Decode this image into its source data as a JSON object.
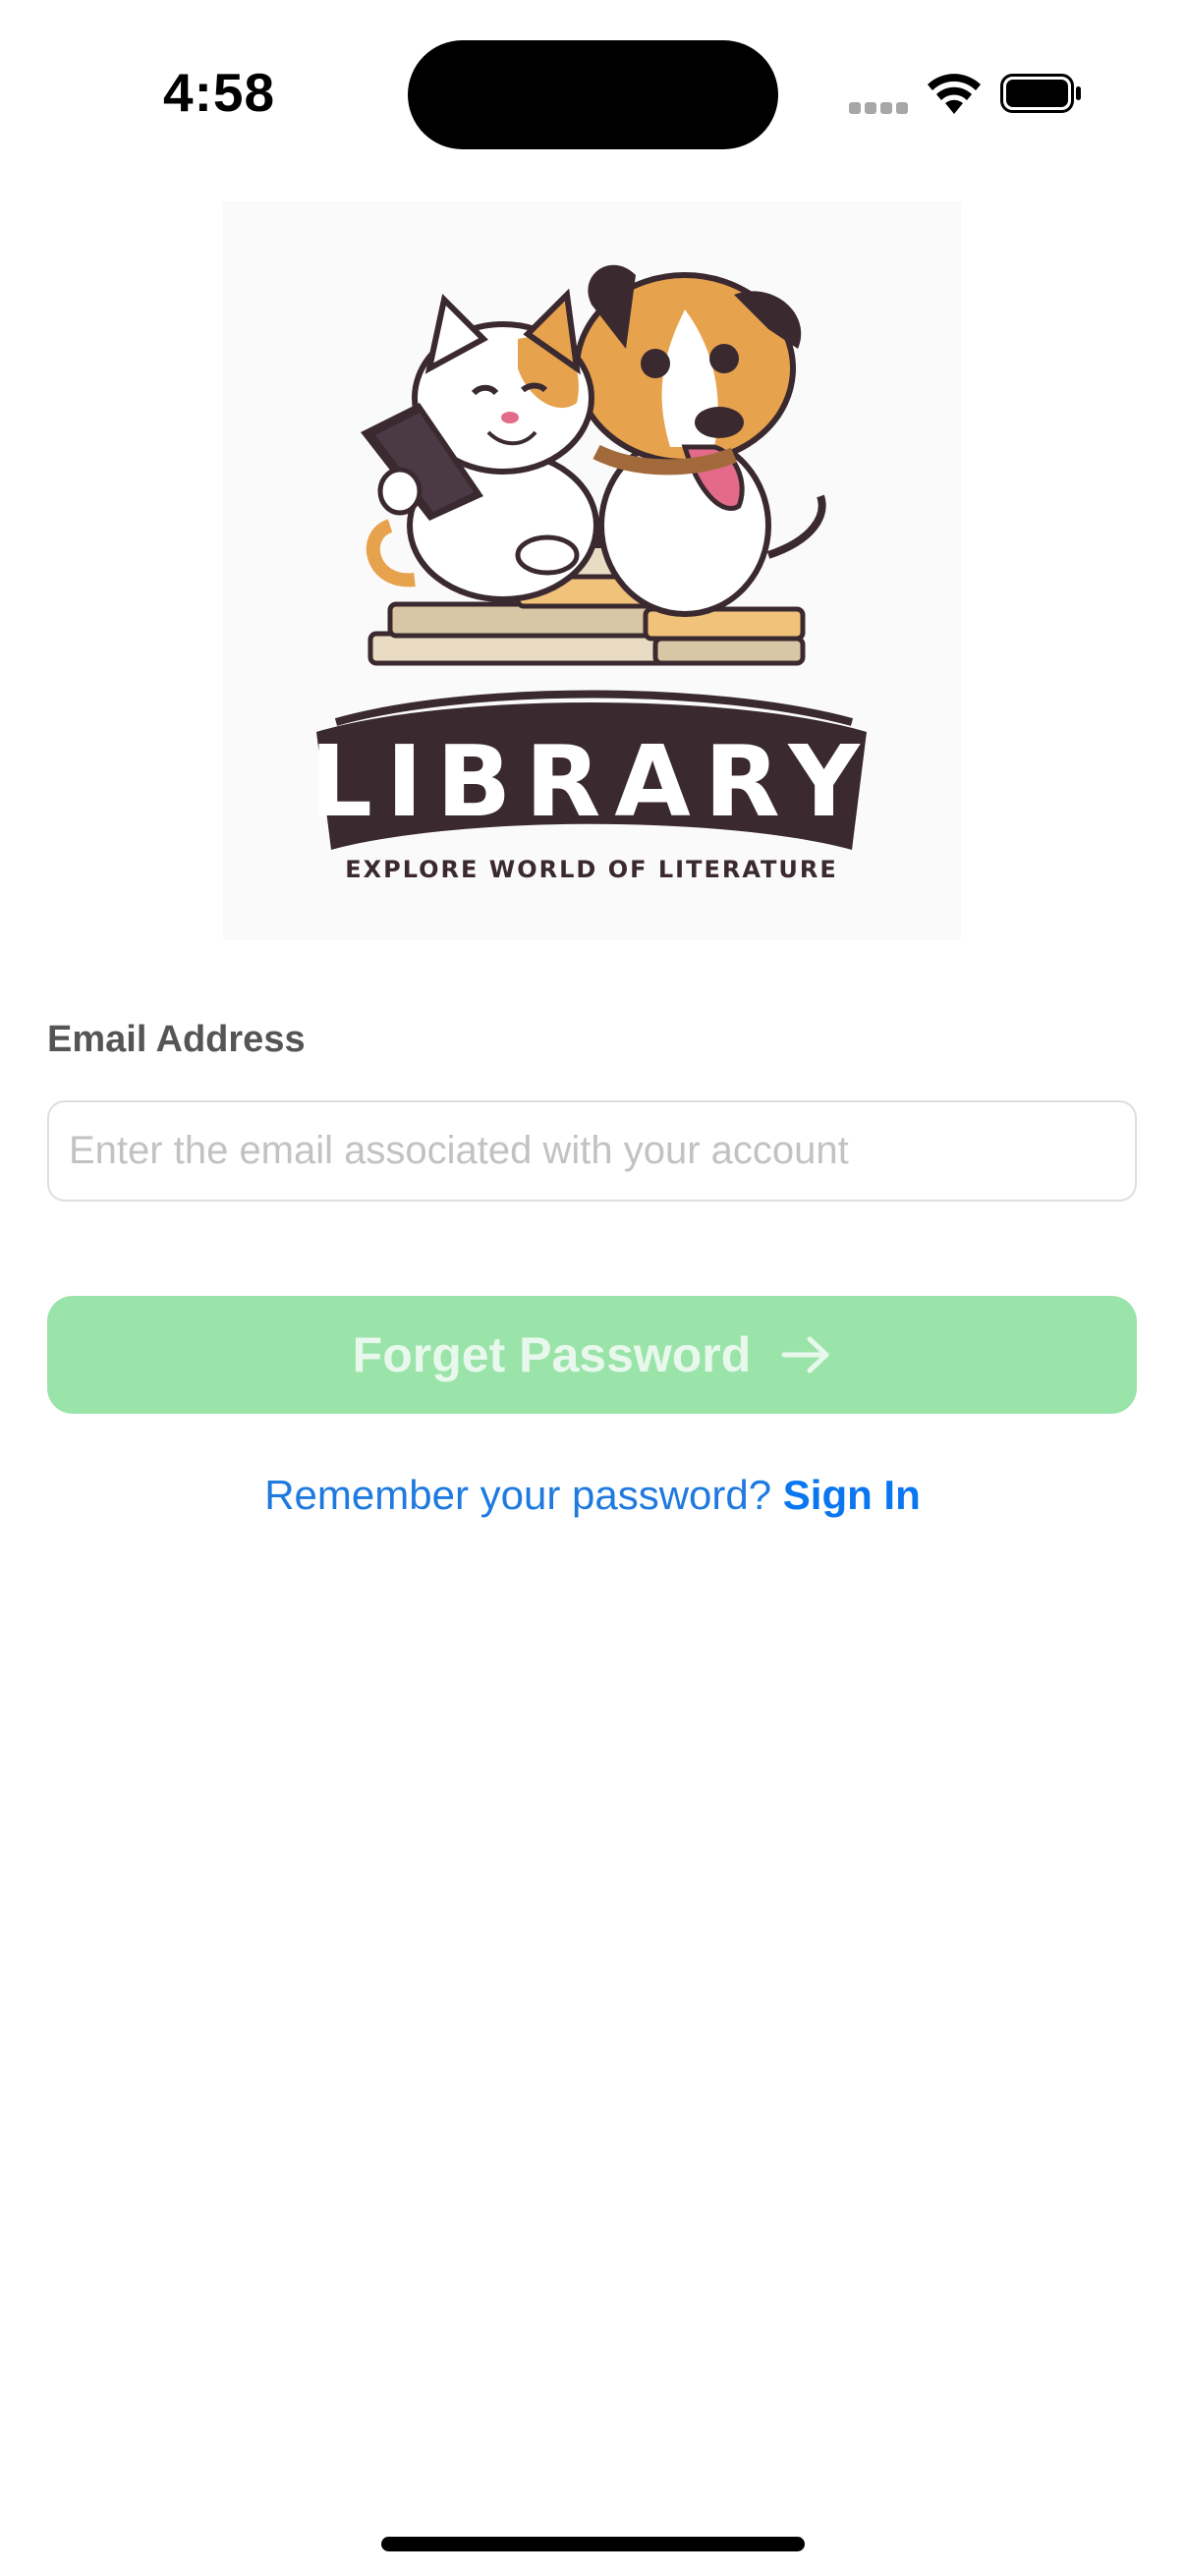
{
  "status_bar": {
    "time": "4:58",
    "icons": [
      "signal-dots-icon",
      "wifi-icon",
      "battery-icon"
    ]
  },
  "logo": {
    "title": "LIBRARY",
    "tagline": "EXPLORE WORLD OF LITERATURE",
    "illustration": "cat-and-dog-reading-books"
  },
  "form": {
    "email_label": "Email Address",
    "email_placeholder": "Enter the email associated with your account",
    "email_value": "",
    "submit_label": "Forget Password",
    "submit_icon": "arrow-right-icon"
  },
  "footer": {
    "prompt": "Remember your password?",
    "link": "Sign In"
  },
  "colors": {
    "button_bg": "#9ae4aa",
    "button_text": "#e9f8ec",
    "link": "#0a76f0",
    "label": "#555555",
    "placeholder": "#c2c2c2",
    "logo_dark": "#3a2a30"
  }
}
